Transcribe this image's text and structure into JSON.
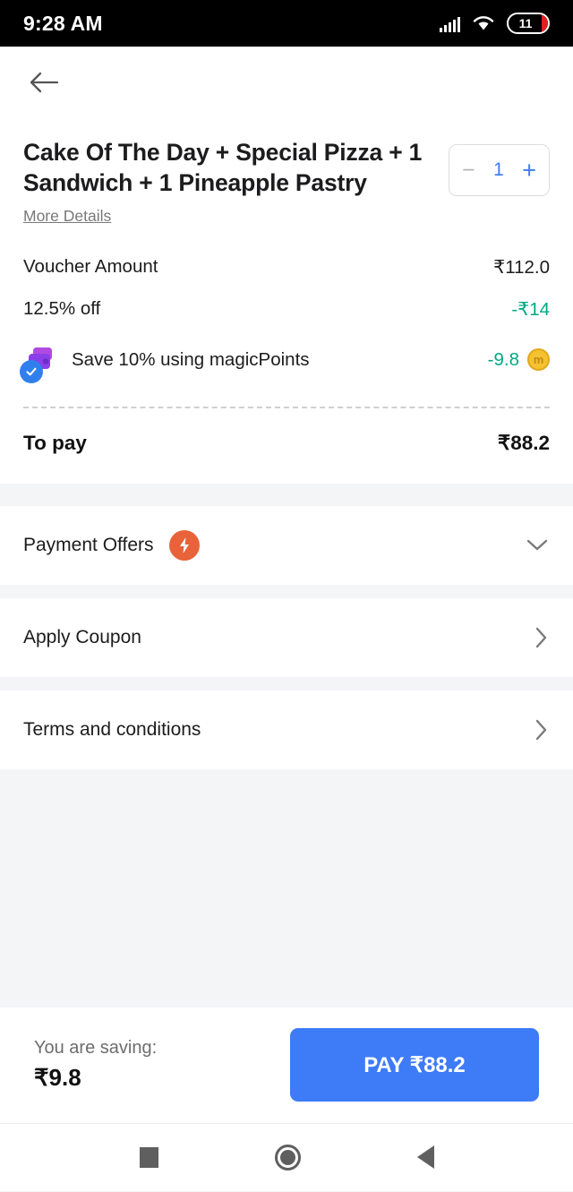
{
  "status_bar": {
    "time": "9:28 AM",
    "battery_level": "11",
    "signal_icon": "signal-bars-icon",
    "wifi_icon": "wifi-icon"
  },
  "app_bar": {
    "back_icon": "back-arrow-icon"
  },
  "order": {
    "title": "Cake Of The Day + Special Pizza + 1 Sandwich + 1 Pineapple Pastry",
    "more_details_label": "More Details",
    "stepper": {
      "minus_label": "−",
      "quantity": "1",
      "plus_label": "+"
    }
  },
  "price_rows": [
    {
      "label": "Voucher Amount",
      "value": "₹112.0",
      "discount": false
    },
    {
      "label": "12.5% off",
      "value": "-₹14",
      "discount": true
    }
  ],
  "magic_points": {
    "label": "Save 10% using magicPoints",
    "value": "-9.8",
    "wallet_icon": "wallet-icon",
    "check_icon": "check-circle-icon",
    "coin_icon": "coin-icon",
    "coin_glyph": "m"
  },
  "to_pay": {
    "label": "To pay",
    "value": "₹88.2"
  },
  "menu_rows": [
    {
      "label": "Payment Offers",
      "icon": "lightning-bolt-icon",
      "chevron": "chevron-down-icon"
    },
    {
      "label": "Apply Coupon",
      "icon": null,
      "chevron": "chevron-right-icon"
    },
    {
      "label": "Terms and conditions",
      "icon": null,
      "chevron": "chevron-right-icon"
    }
  ],
  "bottom_bar": {
    "saving_label": "You are saving:",
    "saving_value": "₹9.8",
    "pay_button_label": "PAY ₹88.2"
  },
  "nav_bar": {
    "recents_icon": "recents-square-icon",
    "home_icon": "home-circle-icon",
    "back_icon": "back-triangle-icon"
  },
  "colors": {
    "accent_blue": "#3d7bf7",
    "discount_green": "#00a884",
    "offer_orange": "#e8633a",
    "page_bg": "#f4f5f7"
  }
}
